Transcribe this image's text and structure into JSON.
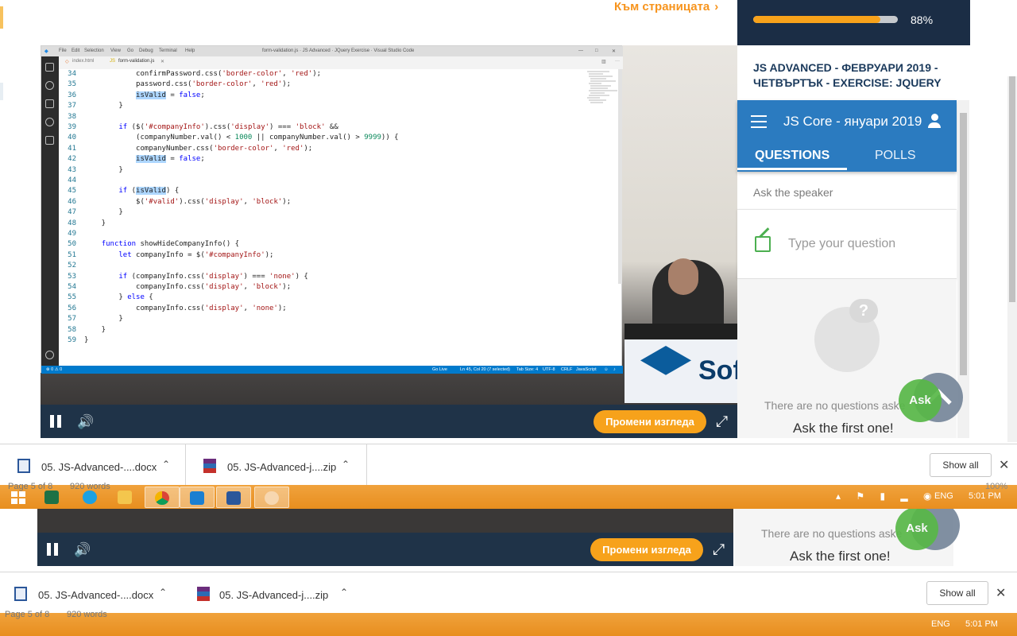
{
  "top": {
    "page_link": "Към страницата",
    "progress_percent": 88,
    "progress_label": "88%",
    "course_title": "JS ADVANCED - ФЕВРУАРИ 2019 - ЧЕТВЪРТЪК - EXERCISE: JQUERY"
  },
  "vscode": {
    "menu": [
      "File",
      "Edit",
      "Selection",
      "View",
      "Go",
      "Debug",
      "Terminal",
      "Help"
    ],
    "window_title": "form-validation.js · JS Advanced · JQuery Exercise · Visual Studio Code",
    "tabs": [
      "index.html",
      "form-validation.js"
    ],
    "code_lines": [
      {
        "n": "34",
        "t": "            confirmPassword.css('border-color', 'red');"
      },
      {
        "n": "35",
        "t": "            password.css('border-color', 'red');"
      },
      {
        "n": "36",
        "t": "            isValid = false;"
      },
      {
        "n": "37",
        "t": "        }"
      },
      {
        "n": "38",
        "t": ""
      },
      {
        "n": "39",
        "t": "        if ($('#companyInfo').css('display') === 'block' &&"
      },
      {
        "n": "40",
        "t": "            (companyNumber.val() < 1000 || companyNumber.val() > 9999)) {"
      },
      {
        "n": "41",
        "t": "            companyNumber.css('border-color', 'red');"
      },
      {
        "n": "42",
        "t": "            isValid = false;"
      },
      {
        "n": "43",
        "t": "        }"
      },
      {
        "n": "44",
        "t": ""
      },
      {
        "n": "45",
        "t": "        if (isValid) {"
      },
      {
        "n": "46",
        "t": "            $('#valid').css('display', 'block');"
      },
      {
        "n": "47",
        "t": "        }"
      },
      {
        "n": "48",
        "t": "    }"
      },
      {
        "n": "49",
        "t": ""
      },
      {
        "n": "50",
        "t": "    function showHideCompanyInfo() {"
      },
      {
        "n": "51",
        "t": "        let companyInfo = $('#companyInfo');"
      },
      {
        "n": "52",
        "t": ""
      },
      {
        "n": "53",
        "t": "        if (companyInfo.css('display') === 'none') {"
      },
      {
        "n": "54",
        "t": "            companyInfo.css('display', 'block');"
      },
      {
        "n": "55",
        "t": "        } else {"
      },
      {
        "n": "56",
        "t": "            companyInfo.css('display', 'none');"
      },
      {
        "n": "57",
        "t": "        }"
      },
      {
        "n": "58",
        "t": "    }"
      },
      {
        "n": "59",
        "t": "}"
      }
    ],
    "status_left": "⊗ 0 ⚠ 0",
    "status_right": [
      "Go Live",
      "Ln 45, Col 20 (7 selected)",
      "Tab Size: 4",
      "UTF-8",
      "CRLF",
      "JavaScript"
    ]
  },
  "video": {
    "banner_text": "Sof",
    "change_view_label": "Промени изгледа"
  },
  "qa": {
    "course_name": "JS Core - януари 2019",
    "tab_questions": "QUESTIONS",
    "tab_polls": "POLLS",
    "ask_speaker": "Ask the speaker",
    "question_placeholder": "Type your question",
    "empty_text": "There are no questions aske",
    "ask_first": "Ask the first one!",
    "ask_button": "Ask"
  },
  "downloads": {
    "items": [
      {
        "name": "05. JS-Advanced-....docx"
      },
      {
        "name": "05. JS-Advanced-j....zip"
      }
    ],
    "show_all": "Show all"
  },
  "word_status": {
    "page": "Page 5 of 8",
    "words": "920 words",
    "zoom": "100%"
  },
  "taskbar": {
    "language": "ENG",
    "time": "5:01 PM"
  },
  "colors": {
    "accent_orange": "#f7a21b",
    "panel_navy": "#1b2d45",
    "qa_blue": "#2b7bc0",
    "ask_green": "#58b848"
  }
}
